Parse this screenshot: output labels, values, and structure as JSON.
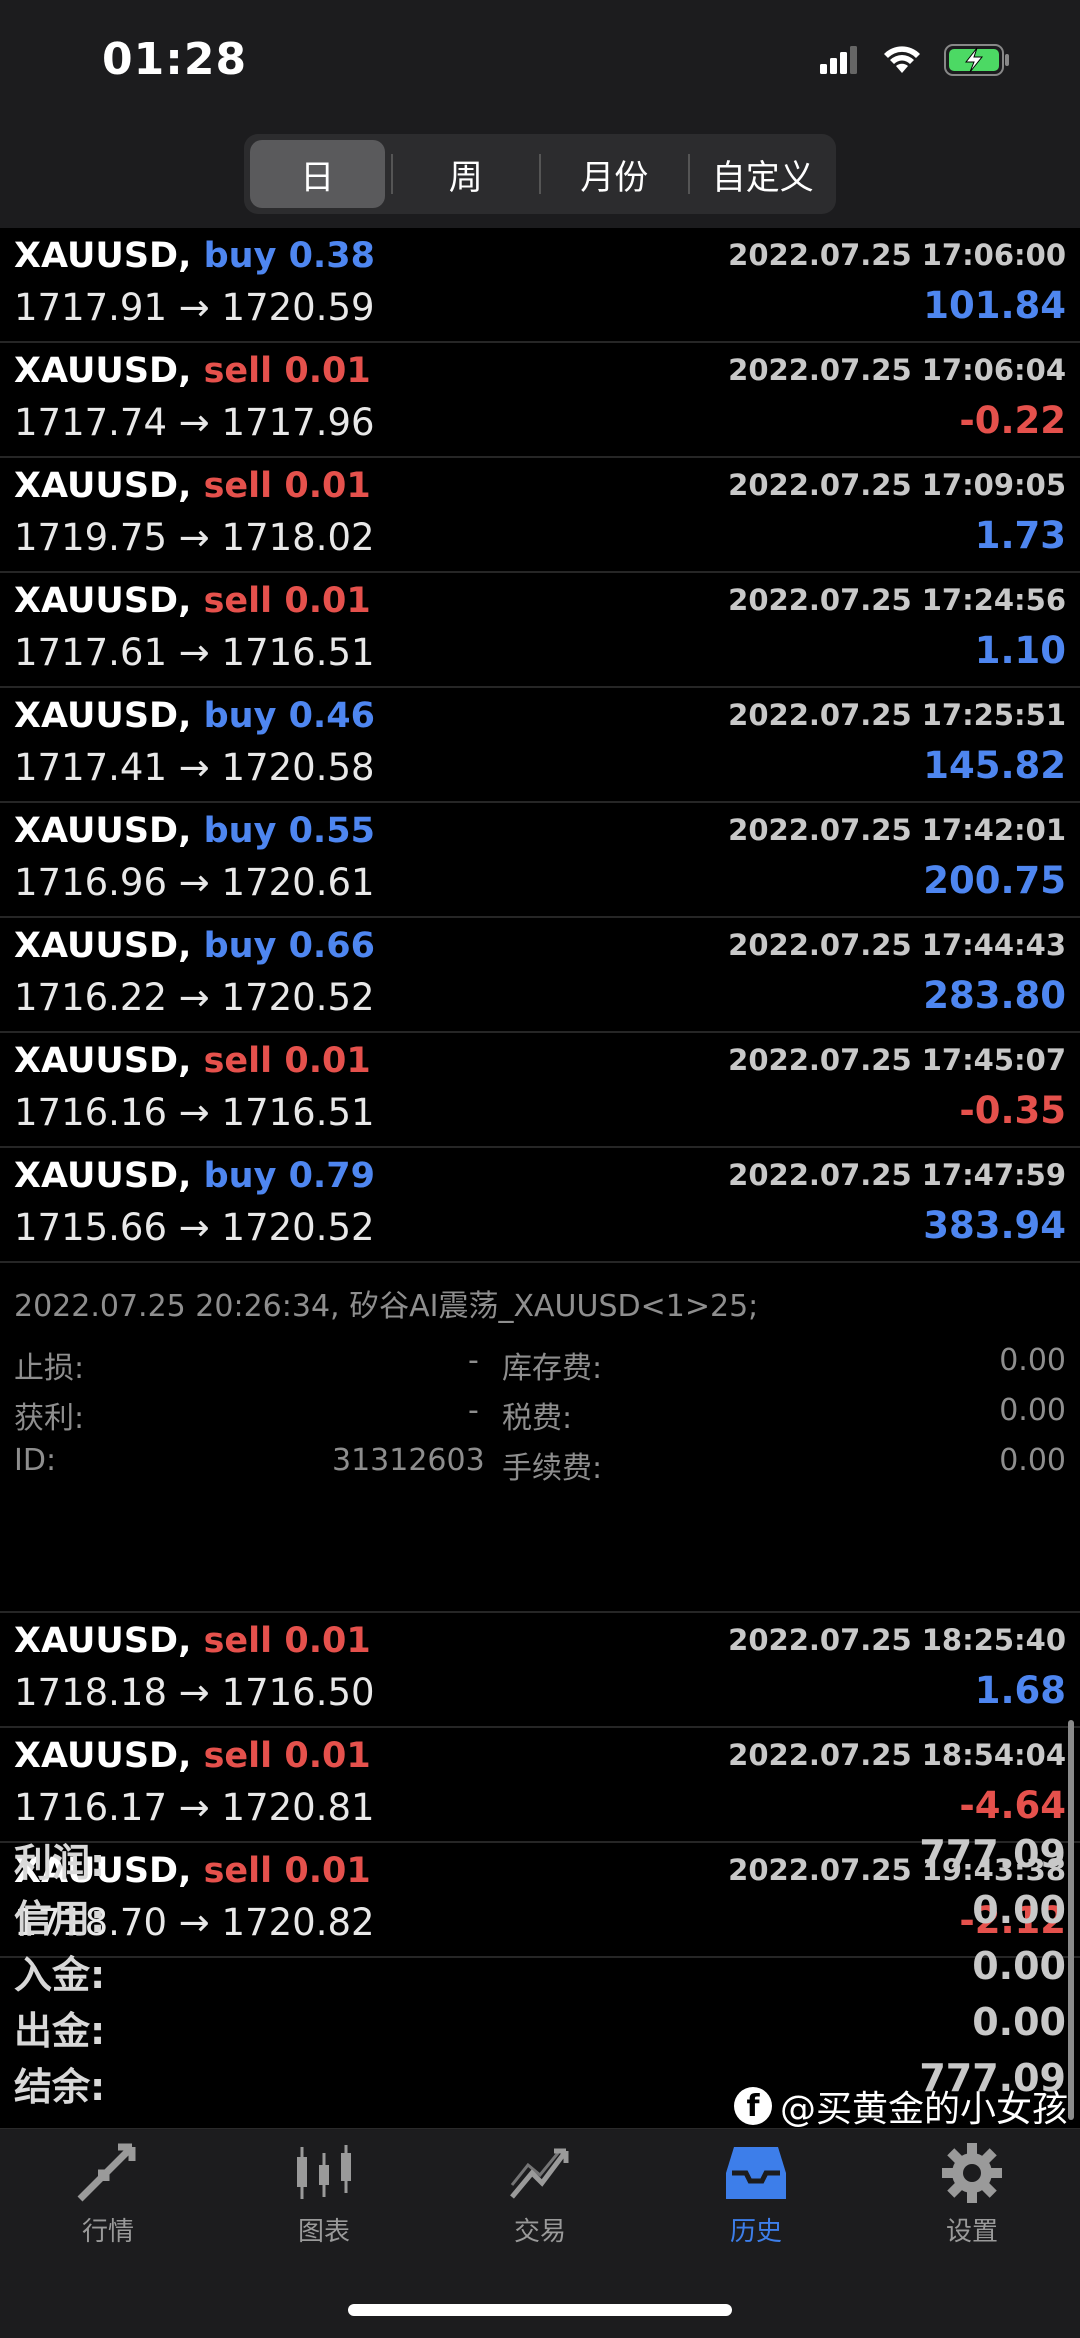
{
  "status_bar": {
    "time": "01:28"
  },
  "period_tabs": [
    {
      "label": "日",
      "active": true
    },
    {
      "label": "周",
      "active": false
    },
    {
      "label": "月份",
      "active": false
    },
    {
      "label": "自定义",
      "active": false
    }
  ],
  "trades": [
    {
      "symbol": "XAUUSD,",
      "side": "buy",
      "volume": "0.38",
      "datetime": "2022.07.25 17:06:00",
      "open": "1717.91",
      "close": "1720.59",
      "profit": "101.84"
    },
    {
      "symbol": "XAUUSD,",
      "side": "sell",
      "volume": "0.01",
      "datetime": "2022.07.25 17:06:04",
      "open": "1717.74",
      "close": "1717.96",
      "profit": "-0.22"
    },
    {
      "symbol": "XAUUSD,",
      "side": "sell",
      "volume": "0.01",
      "datetime": "2022.07.25 17:09:05",
      "open": "1719.75",
      "close": "1718.02",
      "profit": "1.73"
    },
    {
      "symbol": "XAUUSD,",
      "side": "sell",
      "volume": "0.01",
      "datetime": "2022.07.25 17:24:56",
      "open": "1717.61",
      "close": "1716.51",
      "profit": "1.10"
    },
    {
      "symbol": "XAUUSD,",
      "side": "buy",
      "volume": "0.46",
      "datetime": "2022.07.25 17:25:51",
      "open": "1717.41",
      "close": "1720.58",
      "profit": "145.82"
    },
    {
      "symbol": "XAUUSD,",
      "side": "buy",
      "volume": "0.55",
      "datetime": "2022.07.25 17:42:01",
      "open": "1716.96",
      "close": "1720.61",
      "profit": "200.75"
    },
    {
      "symbol": "XAUUSD,",
      "side": "buy",
      "volume": "0.66",
      "datetime": "2022.07.25 17:44:43",
      "open": "1716.22",
      "close": "1720.52",
      "profit": "283.80"
    },
    {
      "symbol": "XAUUSD,",
      "side": "sell",
      "volume": "0.01",
      "datetime": "2022.07.25 17:45:07",
      "open": "1716.16",
      "close": "1716.51",
      "profit": "-0.35"
    },
    {
      "symbol": "XAUUSD,",
      "side": "buy",
      "volume": "0.79",
      "datetime": "2022.07.25 17:47:59",
      "open": "1715.66",
      "close": "1720.52",
      "profit": "383.94"
    }
  ],
  "detail": {
    "comment": "2022.07.25 20:26:34, 矽谷AI震荡_XAUUSD<1>25;",
    "stop_loss_label": "止损:",
    "stop_loss_value": "-",
    "take_profit_label": "获利:",
    "take_profit_value": "-",
    "id_label": "ID:",
    "id_value": "31312603",
    "swap_label": "库存费:",
    "swap_value": "0.00",
    "tax_label": "税费:",
    "tax_value": "0.00",
    "fee_label": "手续费:",
    "fee_value": "0.00"
  },
  "trades_after": [
    {
      "symbol": "XAUUSD,",
      "side": "sell",
      "volume": "0.01",
      "datetime": "2022.07.25 18:25:40",
      "open": "1718.18",
      "close": "1716.50",
      "profit": "1.68"
    },
    {
      "symbol": "XAUUSD,",
      "side": "sell",
      "volume": "0.01",
      "datetime": "2022.07.25 18:54:04",
      "open": "1716.17",
      "close": "1720.81",
      "profit": "-4.64"
    },
    {
      "symbol": "XAUUSD,",
      "side": "sell",
      "volume": "0.01",
      "datetime": "2022.07.25 19:43:38",
      "open": "1718.70",
      "close": "1720.82",
      "profit": "-2.12"
    }
  ],
  "summary": [
    {
      "label": "利润:",
      "value": "777.09"
    },
    {
      "label": "信用:",
      "value": "0.00"
    },
    {
      "label": "入金:",
      "value": "0.00"
    },
    {
      "label": "出金:",
      "value": "0.00"
    },
    {
      "label": "结余:",
      "value": "777.09"
    }
  ],
  "tabs": [
    {
      "label": "行情",
      "icon": "quotes-arrows-icon",
      "active": false
    },
    {
      "label": "图表",
      "icon": "candlestick-chart-icon",
      "active": false
    },
    {
      "label": "交易",
      "icon": "trade-line-icon",
      "active": false
    },
    {
      "label": "历史",
      "icon": "history-inbox-icon",
      "active": true
    },
    {
      "label": "设置",
      "icon": "gear-icon",
      "active": false
    }
  ],
  "watermark": "@买黄金的小女孩",
  "colors": {
    "buy": "#4e86f0",
    "sell": "#e5514c",
    "active_tab": "#3d7eea"
  }
}
